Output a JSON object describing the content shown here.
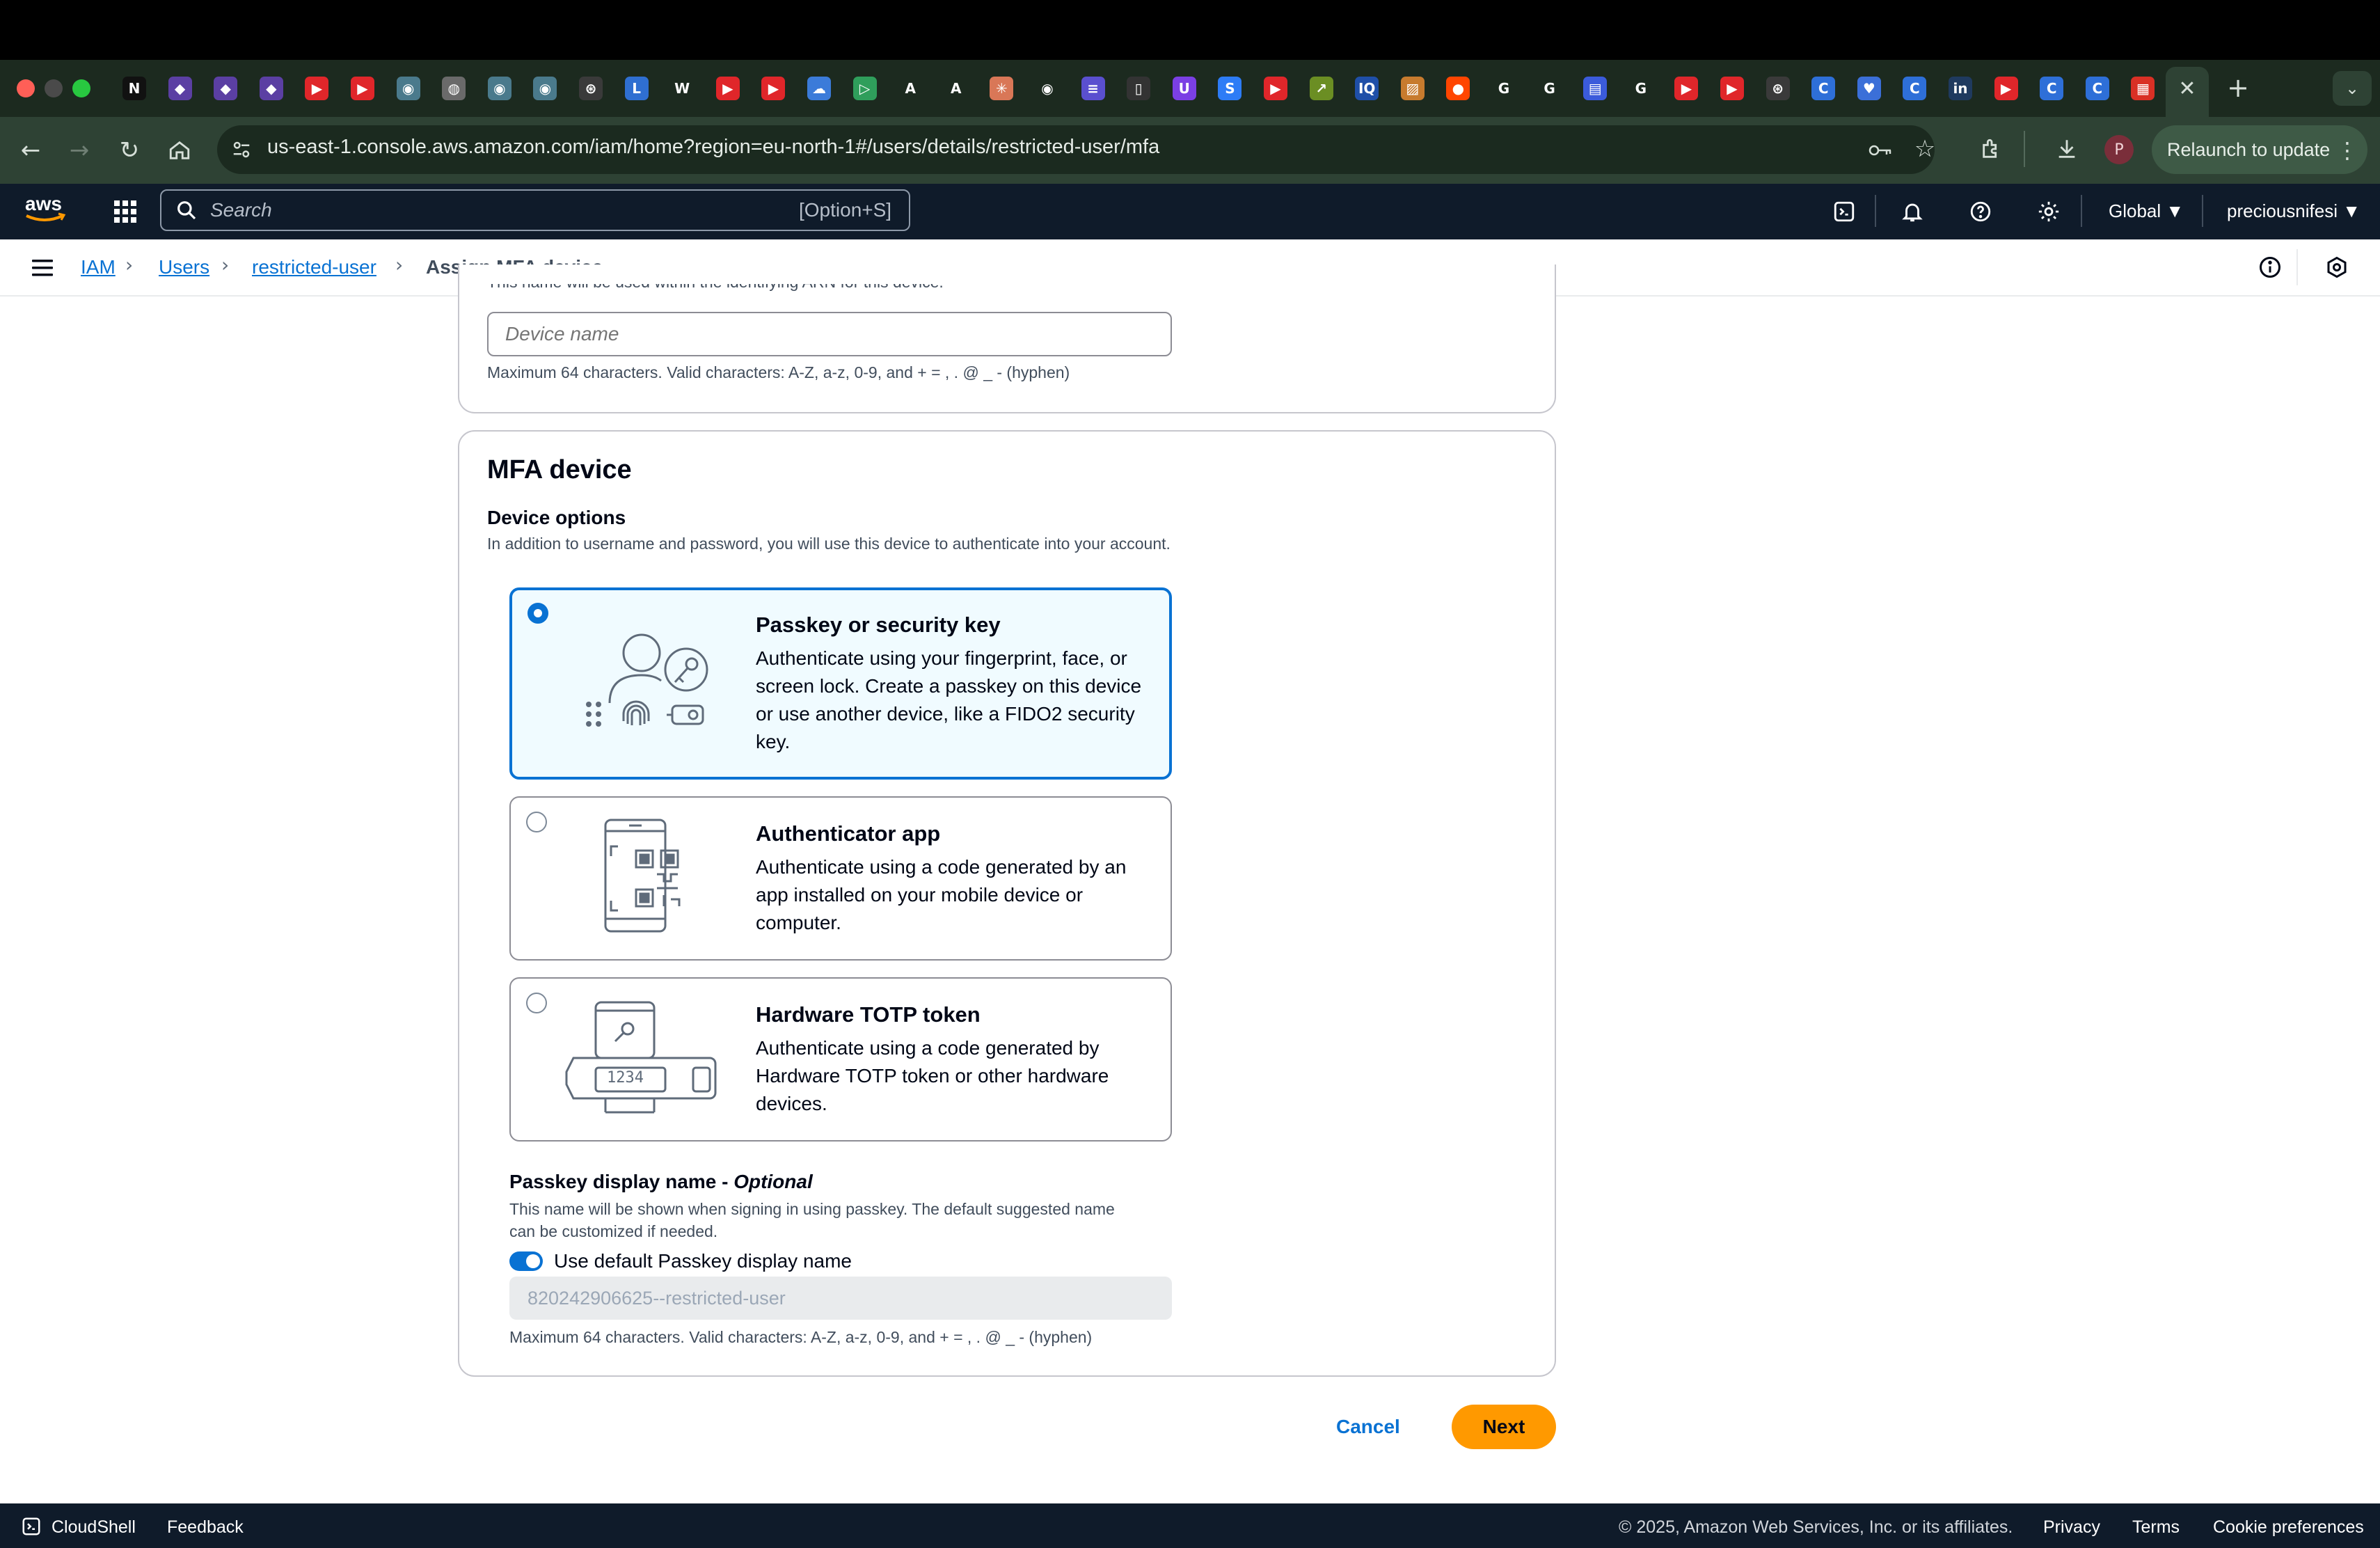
{
  "browser": {
    "url": "us-east-1.console.aws.amazon.com/iam/home?region=eu-north-1#/users/details/restricted-user/mfa",
    "relaunch_label": "Relaunch to update",
    "profile_initial": "P",
    "tabs": [
      {
        "icon": "notion-icon",
        "color": "#111111"
      },
      {
        "icon": "ico-icon",
        "color": "#5b3fa3"
      },
      {
        "icon": "ico-icon",
        "color": "#5b3fa3"
      },
      {
        "icon": "ico-icon",
        "color": "#5b3fa3"
      },
      {
        "icon": "youtube-icon",
        "color": "#e0262a"
      },
      {
        "icon": "youtube-icon",
        "color": "#e0262a"
      },
      {
        "icon": "eye-icon",
        "color": "#4a7a8c"
      },
      {
        "icon": "globe-icon",
        "color": "#6a6a6a"
      },
      {
        "icon": "eye-icon",
        "color": "#4a7a8c"
      },
      {
        "icon": "eye-icon",
        "color": "#4a7a8c"
      },
      {
        "icon": "openai-icon",
        "color": "#3a3a3a"
      },
      {
        "icon": "l-icon",
        "color": "#2f6fd1"
      },
      {
        "icon": "wikipedia-icon",
        "color": "#ffffff"
      },
      {
        "icon": "youtube-icon",
        "color": "#e0262a"
      },
      {
        "icon": "youtube-icon",
        "color": "#e0262a"
      },
      {
        "icon": "cloud-icon",
        "color": "#3b7bd9"
      },
      {
        "icon": "play-icon",
        "color": "#2f9e5b"
      },
      {
        "icon": "anthropic-icon",
        "color": "#ffffff"
      },
      {
        "icon": "anthropic-icon",
        "color": "#ffffff"
      },
      {
        "icon": "claude-icon",
        "color": "#d97757"
      },
      {
        "icon": "github-icon",
        "color": "#ffffff"
      },
      {
        "icon": "list-icon",
        "color": "#5a4fcf"
      },
      {
        "icon": "app-icon",
        "color": "#333333"
      },
      {
        "icon": "u-icon",
        "color": "#7b3fe4"
      },
      {
        "icon": "s-icon",
        "color": "#2d7cf6"
      },
      {
        "icon": "youtube-icon",
        "color": "#e0262a"
      },
      {
        "icon": "trend-icon",
        "color": "#6b8e23"
      },
      {
        "icon": "iq-icon",
        "color": "#1f4fa8"
      },
      {
        "icon": "image-icon",
        "color": "#c77b2e"
      },
      {
        "icon": "reddit-icon",
        "color": "#ff4500"
      },
      {
        "icon": "google-icon",
        "color": "#ffffff"
      },
      {
        "icon": "google-icon",
        "color": "#ffffff"
      },
      {
        "icon": "docs-icon",
        "color": "#3b5bdb"
      },
      {
        "icon": "google-icon",
        "color": "#ffffff"
      },
      {
        "icon": "youtube-icon",
        "color": "#e0262a"
      },
      {
        "icon": "youtube-icon",
        "color": "#e0262a"
      },
      {
        "icon": "openai-icon",
        "color": "#3a3a3a"
      },
      {
        "icon": "c-icon",
        "color": "#2e6fd8"
      },
      {
        "icon": "heart-icon",
        "color": "#3b6fd8"
      },
      {
        "icon": "c-icon",
        "color": "#2e6fd8"
      },
      {
        "icon": "inc-icon",
        "color": "#1f3a5f"
      },
      {
        "icon": "youtube-icon",
        "color": "#e0262a"
      },
      {
        "icon": "c-icon",
        "color": "#2e6fd8"
      },
      {
        "icon": "c-icon",
        "color": "#2e6fd8"
      },
      {
        "icon": "calendar-icon",
        "color": "#d93025"
      }
    ]
  },
  "aws_header": {
    "search_placeholder": "Search",
    "search_shortcut": "[Option+S]",
    "region": "Global",
    "account": "preciousnifesi"
  },
  "breadcrumb": {
    "items": [
      "IAM",
      "Users",
      "restricted-user"
    ],
    "current": "Assign MFA device"
  },
  "device_name_section": {
    "clipped_hint": "This name will be used within the identifying ARN for this device.",
    "placeholder": "Device name",
    "constraint": "Maximum 64 characters. Valid characters: A-Z, a-z, 0-9, and + = , . @ _ - (hyphen)"
  },
  "mfa_section": {
    "title": "MFA device",
    "options_label": "Device options",
    "options_desc": "In addition to username and password, you will use this device to authenticate into your account.",
    "options": [
      {
        "title": "Passkey or security key",
        "desc": "Authenticate using your fingerprint, face, or screen lock. Create a passkey on this device or use another device, like a FIDO2 security key.",
        "selected": true
      },
      {
        "title": "Authenticator app",
        "desc": "Authenticate using a code generated by an app installed on your mobile device or computer.",
        "selected": false
      },
      {
        "title": "Hardware TOTP token",
        "desc": "Authenticate using a code generated by Hardware TOTP token or other hardware devices.",
        "selected": false,
        "token_display": "1234"
      }
    ],
    "passkey_label": "Passkey display name - ",
    "passkey_optional": "Optional",
    "passkey_desc_1": "This name will be shown when signing in using passkey. The default suggested name",
    "passkey_desc_2": "can be customized if needed.",
    "toggle_label": "Use default Passkey display name",
    "toggle_on": true,
    "passkey_value": "820242906625--restricted-user",
    "passkey_constraint": "Maximum 64 characters. Valid characters: A-Z, a-z, 0-9, and + = , . @ _ - (hyphen)"
  },
  "actions": {
    "cancel": "Cancel",
    "next": "Next"
  },
  "footer": {
    "cloudshell": "CloudShell",
    "feedback": "Feedback",
    "copyright": "© 2025, Amazon Web Services, Inc. or its affiliates.",
    "privacy": "Privacy",
    "terms": "Terms",
    "cookies": "Cookie preferences"
  },
  "colors": {
    "accent": "#0972d3",
    "primary_button": "#ff9900",
    "aws_header": "#0f1b2a",
    "browser_toolbar": "#2e4234"
  }
}
